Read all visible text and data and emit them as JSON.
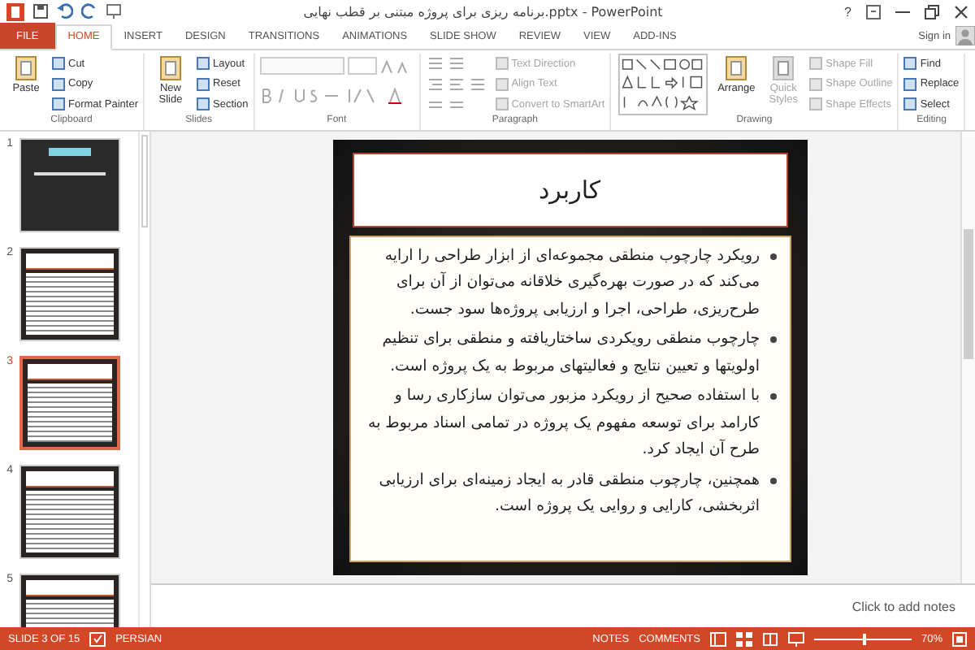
{
  "title_bar": {
    "title": "برنامه ریزی برای پروژه مبتنی بر قطب نهایی.pptx - PowerPoint",
    "help": "?",
    "sign_in": "Sign in"
  },
  "tabs": [
    {
      "label": "FILE",
      "kind": "file",
      "selected": false
    },
    {
      "label": "HOME",
      "kind": "tab",
      "selected": true
    },
    {
      "label": "INSERT",
      "kind": "tab",
      "selected": false
    },
    {
      "label": "DESIGN",
      "kind": "tab",
      "selected": false
    },
    {
      "label": "TRANSITIONS",
      "kind": "tab",
      "selected": false
    },
    {
      "label": "ANIMATIONS",
      "kind": "tab",
      "selected": false
    },
    {
      "label": "SLIDE SHOW",
      "kind": "tab",
      "selected": false
    },
    {
      "label": "REVIEW",
      "kind": "tab",
      "selected": false
    },
    {
      "label": "VIEW",
      "kind": "tab",
      "selected": false
    },
    {
      "label": "ADD-INS",
      "kind": "tab",
      "selected": false
    }
  ],
  "ribbon": [
    {
      "label": "Clipboard",
      "items": [
        {
          "kind": "large",
          "label": "Paste",
          "disabled": false
        },
        {
          "kind": "small",
          "label": "Cut",
          "disabled": false
        },
        {
          "kind": "small",
          "label": "Copy",
          "disabled": false
        },
        {
          "kind": "small",
          "label": "Format Painter",
          "disabled": false
        }
      ]
    },
    {
      "label": "Slides",
      "items": [
        {
          "kind": "large",
          "label": "New Slide",
          "disabled": false
        },
        {
          "kind": "small",
          "label": "Layout",
          "disabled": false
        },
        {
          "kind": "small",
          "label": "Reset",
          "disabled": false
        },
        {
          "kind": "small",
          "label": "Section",
          "disabled": false
        }
      ]
    },
    {
      "label": "Font",
      "items": [
        {
          "kind": "font-controls",
          "disabled": true
        }
      ]
    },
    {
      "label": "Paragraph",
      "items": [
        {
          "kind": "para-controls",
          "disabled": true
        },
        {
          "kind": "small",
          "label": "Text Direction",
          "disabled": true
        },
        {
          "kind": "small",
          "label": "Align Text",
          "disabled": true
        },
        {
          "kind": "small",
          "label": "Convert to SmartArt",
          "disabled": true
        }
      ]
    },
    {
      "label": "Drawing",
      "items": [
        {
          "kind": "shape-gallery",
          "disabled": false
        },
        {
          "kind": "large",
          "label": "Arrange",
          "disabled": false
        },
        {
          "kind": "large",
          "label": "Quick Styles",
          "disabled": true
        },
        {
          "kind": "small",
          "label": "Shape Fill",
          "disabled": true
        },
        {
          "kind": "small",
          "label": "Shape Outline",
          "disabled": true
        },
        {
          "kind": "small",
          "label": "Shape Effects",
          "disabled": true
        }
      ]
    },
    {
      "label": "Editing",
      "items": [
        {
          "kind": "small",
          "label": "Find",
          "disabled": false
        },
        {
          "kind": "small",
          "label": "Replace",
          "disabled": false
        },
        {
          "kind": "small",
          "label": "Select",
          "disabled": false
        }
      ]
    }
  ],
  "thumbnails": [
    {
      "number": "1",
      "kind": "title",
      "selected": false
    },
    {
      "number": "2",
      "kind": "content",
      "selected": false
    },
    {
      "number": "3",
      "kind": "content",
      "selected": true
    },
    {
      "number": "4",
      "kind": "content",
      "selected": false
    },
    {
      "number": "5",
      "kind": "content",
      "selected": false
    }
  ],
  "slide": {
    "title": "کاربرد",
    "bullets": [
      "رویکرد چارچوب منطقی مجموعه‌ای از ابزار طراحی را ارایه می‌کند که در صورت بهره‌گیری خلاقانه می‌توان از آن برای طرح‌ریزی، طراحی، اجرا و ارزیابی پروژه‌ها سود جست.",
      "چارچوب منطقی رویکردی ساختاریافته و منطقی برای تنظیم اولویتها و تعیین نتایج و فعالیتهای مربوط به یک پروژه است.",
      "با استفاده صحیح از رویکرد مزبور می‌توان سازکاری رسا و کارامد برای توسعه مفهوم یک پروژه در تمامی اسناد مربوط به طرح آن ایجاد کرد.",
      "همچنین، چارچوب منطقی قادر به ایجاد زمینه‌ای برای ارزیابی اثربخشی، کارایی و روایی یک پروژه است."
    ]
  },
  "notes": {
    "placeholder": "Click to add notes"
  },
  "status_bar": {
    "slide_info": "SLIDE 3 OF 15",
    "language": "PERSIAN",
    "notes": "NOTES",
    "comments": "COMMENTS",
    "zoom": "70%",
    "zoom_level": {
      "level": 0.5
    }
  }
}
